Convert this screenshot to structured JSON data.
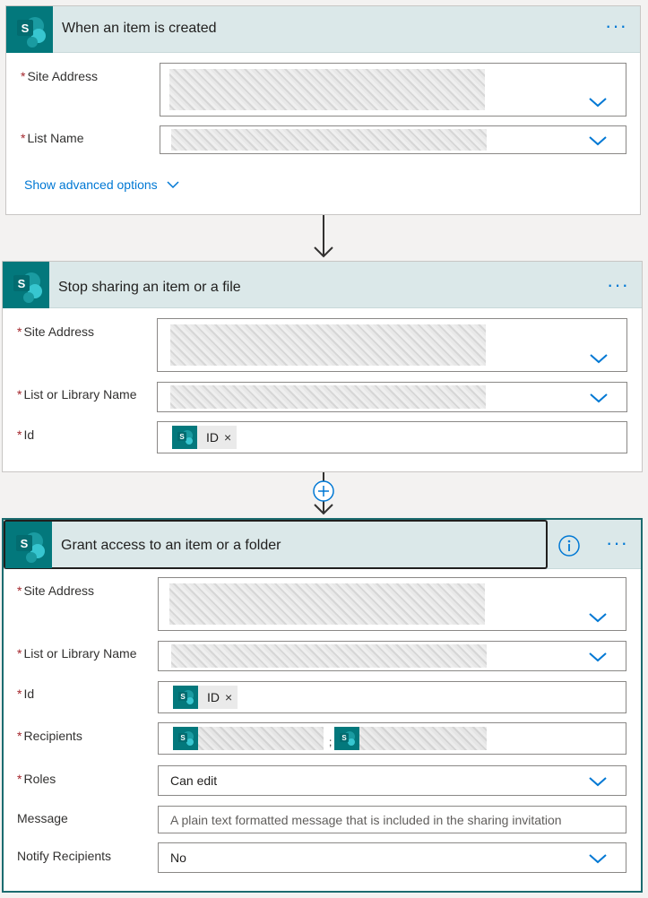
{
  "steps": {
    "trigger": {
      "title": "When an item is created",
      "fields": {
        "site_address_label": "Site Address",
        "list_name_label": "List Name"
      },
      "advanced_label": "Show advanced options"
    },
    "stop_sharing": {
      "title": "Stop sharing an item or a file",
      "fields": {
        "site_address_label": "Site Address",
        "list_label": "List or Library Name",
        "id_label": "Id",
        "id_token": "ID"
      }
    },
    "grant_access": {
      "title": "Grant access to an item or a folder",
      "fields": {
        "site_address_label": "Site Address",
        "list_label": "List or Library Name",
        "id_label": "Id",
        "id_token": "ID",
        "recipients_label": "Recipients",
        "recipients_separator": ";",
        "roles_label": "Roles",
        "roles_value": "Can edit",
        "message_label": "Message",
        "message_placeholder": "A plain text formatted message that is included in the sharing invitation",
        "notify_label": "Notify Recipients",
        "notify_value": "No"
      }
    }
  },
  "common": {
    "required_marker": "*",
    "more_icon": "more-dots-icon",
    "token_remove": "×",
    "sp_letter": "S"
  },
  "colors": {
    "accent": "#0078d4",
    "sharepoint": "#03787c",
    "header_bg": "#dbe8e9",
    "required": "#a4262c"
  }
}
